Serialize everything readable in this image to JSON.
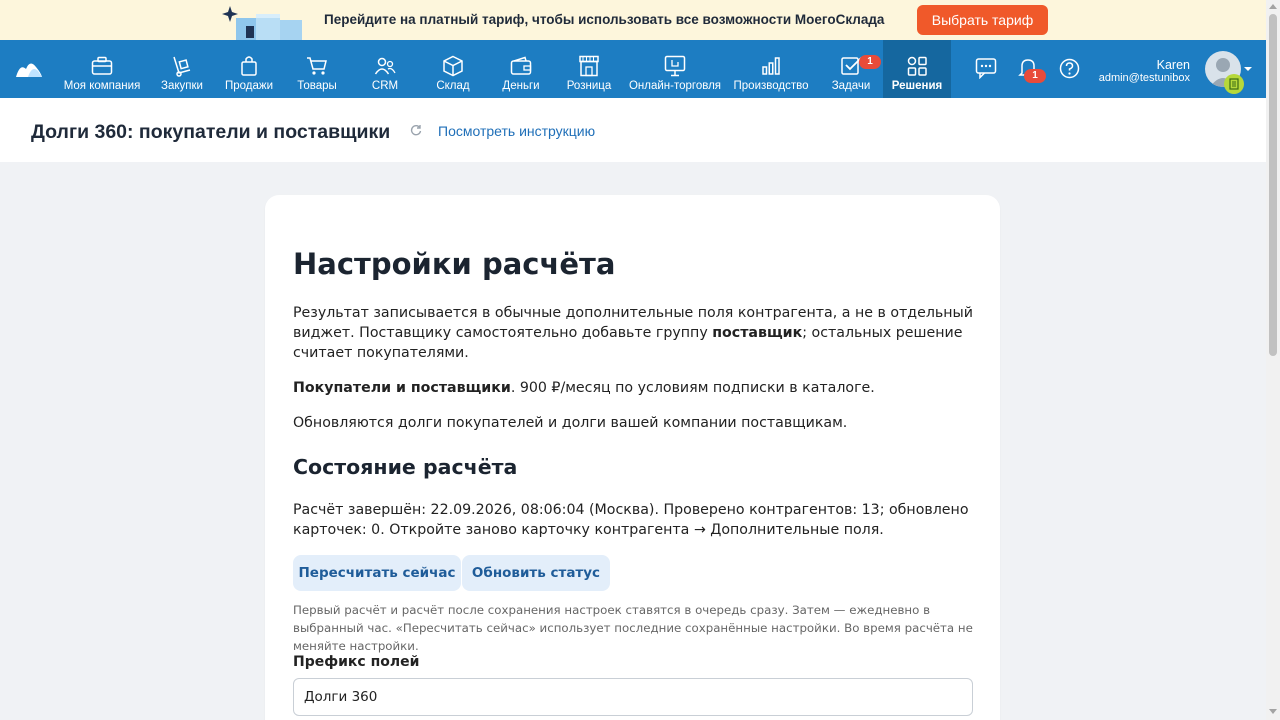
{
  "promo": {
    "text": "Перейдите на платный тариф, чтобы использовать все возможности МоегоСклада",
    "button": "Выбрать тариф"
  },
  "nav": {
    "items": [
      {
        "label": "Моя компания",
        "icon": "briefcase-icon"
      },
      {
        "label": "Закупки",
        "icon": "cart-dolly-icon"
      },
      {
        "label": "Продажи",
        "icon": "shopping-bag-icon"
      },
      {
        "label": "Товары",
        "icon": "shopping-cart-icon"
      },
      {
        "label": "CRM",
        "icon": "users-icon"
      },
      {
        "label": "Склад",
        "icon": "box-icon"
      },
      {
        "label": "Деньги",
        "icon": "wallet-icon"
      },
      {
        "label": "Розница",
        "icon": "store-icon"
      },
      {
        "label": "Онлайн-торговля",
        "icon": "online-store-icon"
      },
      {
        "label": "Производство",
        "icon": "chart-icon"
      },
      {
        "label": "Задачи",
        "icon": "tasks-icon",
        "badge": "1"
      },
      {
        "label": "Решения",
        "icon": "apps-icon",
        "active": true
      }
    ],
    "notifications_badge": "1",
    "user_name": "Karen",
    "user_email": "admin@testunibox"
  },
  "page": {
    "title": "Долги 360: покупатели и поставщики",
    "help_link": "Посмотреть инструкцию"
  },
  "card": {
    "heading": "Настройки расчёта",
    "intro_1": "Результат записывается в обычные дополнительные поля контрагента, а не в отдельный виджет. Поставщику самостоятельно добавьте группу ",
    "intro_1_bold": "поставщик",
    "intro_1_tail": "; остальных решение считает покупателями.",
    "plan_bold": "Покупатели и поставщики",
    "plan_text": ". 900 ₽/месяц по условиям подписки в каталоге.",
    "updates_text": "Обновляются долги покупателей и долги вашей компании поставщикам.",
    "status_heading": "Состояние расчёта",
    "status_text": "Расчёт завершён: 22.09.2026, 08:06:04 (Москва). Проверено контрагентов: 13; обновлено карточек: 0. Откройте заново карточку контрагента → Дополнительные поля.",
    "recalc_button": "Пересчитать сейчас",
    "refresh_button": "Обновить статус",
    "hint": "Первый расчёт и расчёт после сохранения настроек ставятся в очередь сразу. Затем — ежедневно в выбранный час. «Пересчитать сейчас» использует последние сохранённые настройки. Во время расчёта не меняйте настройки.",
    "prefix_label": "Префикс полей",
    "prefix_value": "Долги 360"
  }
}
